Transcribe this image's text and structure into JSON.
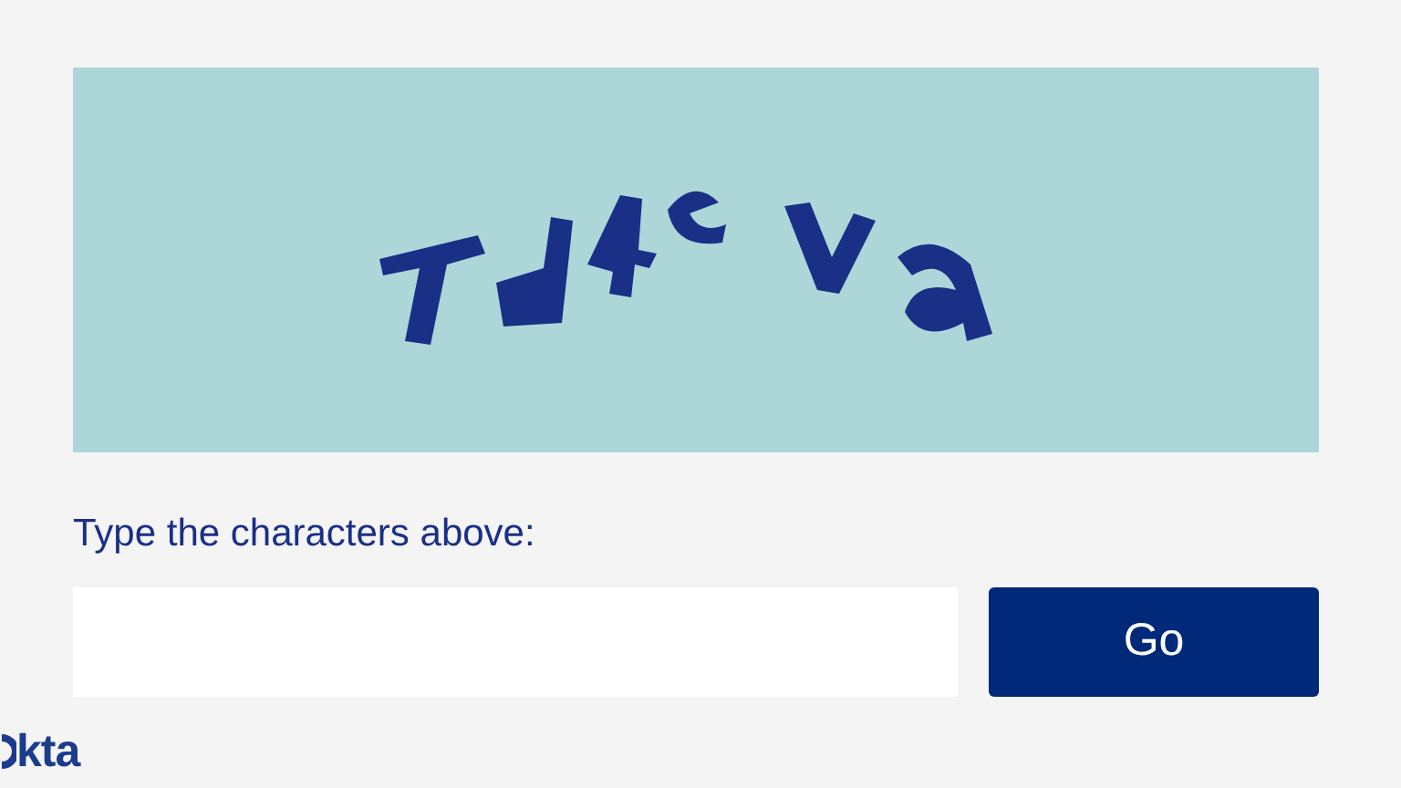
{
  "answer": {
    "label": "Type the characters above:"
  },
  "submit_button": "Go",
  "logo": "kta"
}
